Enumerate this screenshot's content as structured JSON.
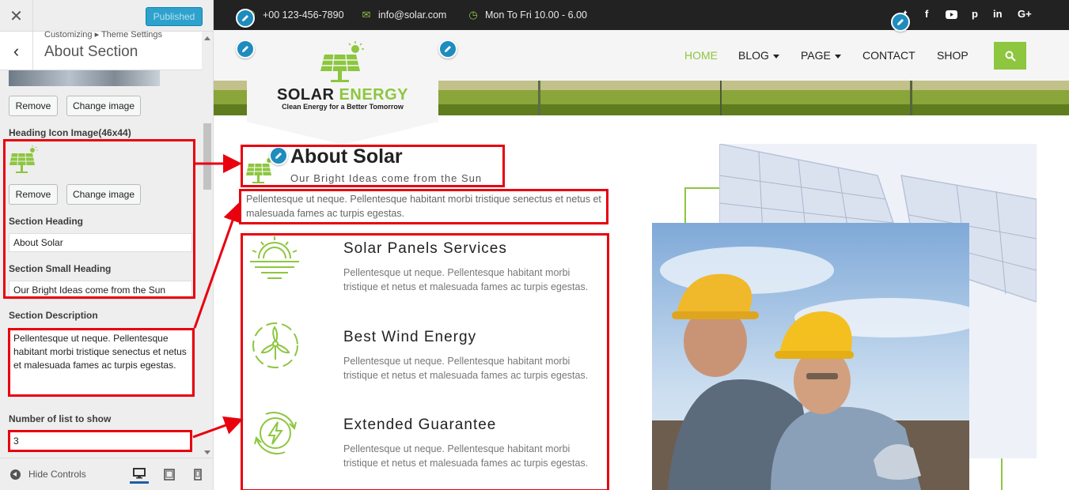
{
  "customizer": {
    "close_icon": "close-icon",
    "publish_label": "Published",
    "breadcrumb": "Customizing ▸ Theme Settings",
    "panel_title": "About Section",
    "remove_label": "Remove",
    "change_image_label": "Change image",
    "heading_icon_label": "Heading Icon Image(46x44)",
    "section_heading_label": "Section Heading",
    "section_heading_value": "About Solar",
    "section_small_heading_label": "Section Small Heading",
    "section_small_heading_value": "Our Bright Ideas come from the Sun",
    "section_description_label": "Section Description",
    "section_description_value": "Pellentesque ut neque. Pellentesque habitant morbi tristique senectus et netus et malesuada fames ac turpis egestas.",
    "list_count_label": "Number of list to show",
    "list_count_value": "3",
    "hide_controls_label": "Hide Controls"
  },
  "site": {
    "phone": "+00 123-456-7890",
    "email": "info@solar.com",
    "hours": "Mon To Fri 10.00 - 6.00",
    "social_icons": [
      "twitter-icon",
      "facebook-icon",
      "youtube-icon",
      "pinterest-icon",
      "linkedin-icon",
      "google-plus-icon"
    ],
    "logo_title_solar": "SOLAR",
    "logo_title_energy": "ENERGY",
    "logo_tagline": "Clean Energy for a Better Tomorrow",
    "nav": {
      "home": "HOME",
      "blog": "BLOG",
      "page": "PAGE",
      "contact": "CONTACT",
      "shop": "SHOP"
    },
    "about": {
      "title": "About Solar",
      "subtitle": "Our Bright Ideas come from the Sun",
      "description": "Pellentesque ut neque. Pellentesque habitant morbi tristique senectus et netus et malesuada fames ac turpis egestas."
    },
    "services": [
      {
        "title": "Solar Panels Services",
        "text": "Pellentesque ut neque. Pellentesque habitant morbi tristique et netus et malesuada fames ac turpis egestas."
      },
      {
        "title": "Best Wind Energy",
        "text": "Pellentesque ut neque. Pellentesque habitant morbi tristique et netus et malesuada fames ac turpis egestas."
      },
      {
        "title": "Extended Guarantee",
        "text": "Pellentesque ut neque. Pellentesque habitant morbi tristique et netus et malesuada fames ac turpis egestas."
      }
    ]
  },
  "colors": {
    "accent_green": "#8dc63f",
    "topbar_bg": "#222222",
    "annotation_red": "#e8000f",
    "edit_blue": "#1e8cbe",
    "publish_blue": "#2ea2cc"
  }
}
